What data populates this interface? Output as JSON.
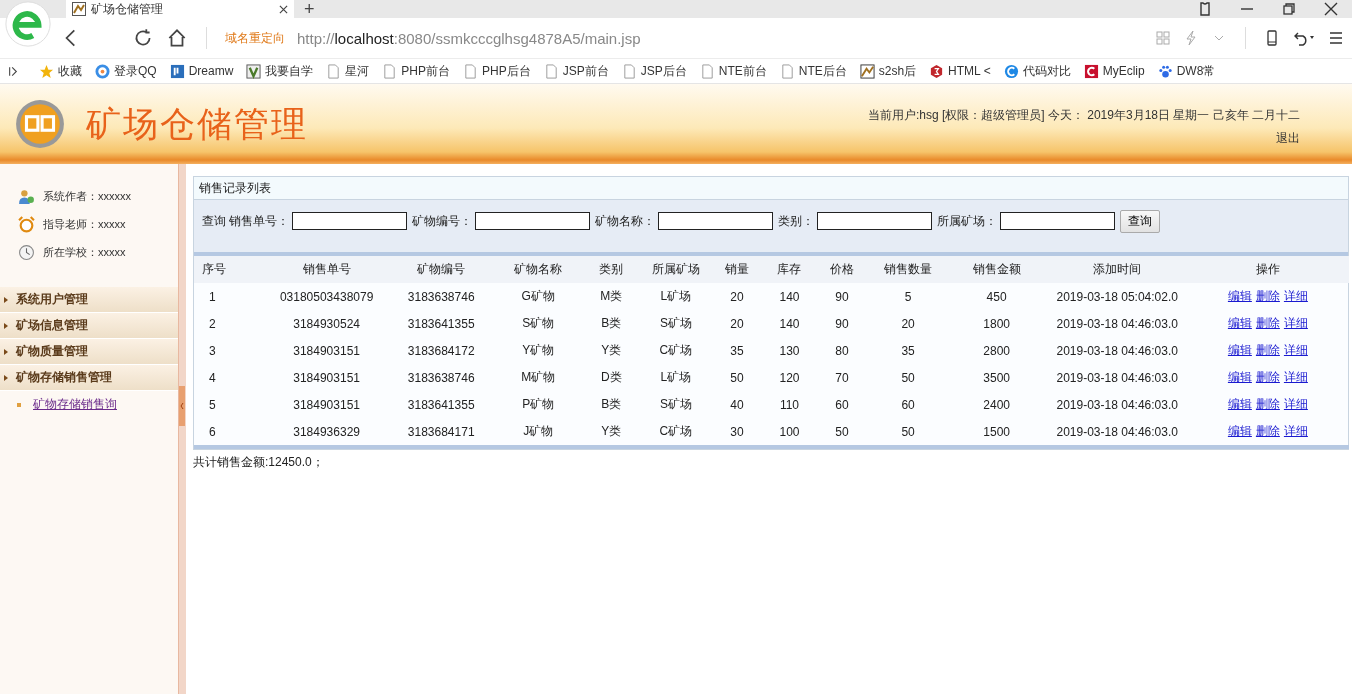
{
  "browser": {
    "tab_title": "矿场仓储管理",
    "new_tab": "+",
    "redirect_label": "域名重定向",
    "url": "http://**localhost**:8080/ssmkcccglhsg4878A5/main.jsp",
    "bookmarks": [
      {
        "label": "收藏",
        "kind": "star"
      },
      {
        "label": "登录QQ",
        "kind": "ring"
      },
      {
        "label": "Dreamw",
        "kind": "square"
      },
      {
        "label": "我要自学",
        "kind": "leaf"
      },
      {
        "label": "星河",
        "kind": "page"
      },
      {
        "label": "PHP前台",
        "kind": "page"
      },
      {
        "label": "PHP后台",
        "kind": "page"
      },
      {
        "label": "JSP前台",
        "kind": "page"
      },
      {
        "label": "JSP后台",
        "kind": "page"
      },
      {
        "label": "NTE前台",
        "kind": "page"
      },
      {
        "label": "NTE后台",
        "kind": "page"
      },
      {
        "label": "s2sh后",
        "kind": "image"
      },
      {
        "label": "HTML <",
        "kind": "hexagon"
      },
      {
        "label": "代码对比",
        "kind": "circle"
      },
      {
        "label": "MyEclip",
        "kind": "badge"
      },
      {
        "label": "DW8常",
        "kind": "paw"
      }
    ]
  },
  "header": {
    "title": "矿场仓储管理",
    "user_info": "当前用户:hsg [权限：超级管理员] 今天： 2019年3月18日 星期一 己亥年 二月十二",
    "logout": "退出"
  },
  "sidebar": {
    "info": [
      {
        "text": "系统作者：xxxxxx"
      },
      {
        "text": "指导老师：xxxxx"
      },
      {
        "text": "所在学校：xxxxx"
      }
    ],
    "menu": [
      {
        "label": "系统用户管理"
      },
      {
        "label": "矿场信息管理"
      },
      {
        "label": "矿物质量管理"
      },
      {
        "label": "矿物存储销售管理",
        "children": [
          {
            "label": "矿物存储销售询"
          }
        ]
      }
    ]
  },
  "panel": {
    "title": "销售记录列表",
    "search_label": "查询",
    "fields": [
      {
        "label": "销售单号："
      },
      {
        "label": "矿物编号："
      },
      {
        "label": "矿物名称："
      },
      {
        "label": "类别："
      },
      {
        "label": "所属矿场："
      }
    ],
    "search_button": "查询",
    "columns": [
      "序号",
      "销售单号",
      "矿物编号",
      "矿物名称",
      "类别",
      "所属矿场",
      "销量",
      "库存",
      "价格",
      "销售数量",
      "销售金额",
      "添加时间",
      "操作"
    ],
    "rows": [
      {
        "cells": [
          "1",
          "03180503438079",
          "3183638746",
          "G矿物",
          "M类",
          "L矿场",
          "20",
          "140",
          "90",
          "5",
          "450",
          "2019-03-18 05:04:02.0"
        ],
        "actions": [
          "编辑",
          "删除",
          "详细"
        ]
      },
      {
        "cells": [
          "2",
          "3184930524",
          "3183641355",
          "S矿物",
          "B类",
          "S矿场",
          "20",
          "140",
          "90",
          "20",
          "1800",
          "2019-03-18 04:46:03.0"
        ],
        "actions": [
          "编辑",
          "删除",
          "详细"
        ]
      },
      {
        "cells": [
          "3",
          "3184903151",
          "3183684172",
          "Y矿物",
          "Y类",
          "C矿场",
          "35",
          "130",
          "80",
          "35",
          "2800",
          "2019-03-18 04:46:03.0"
        ],
        "actions": [
          "编辑",
          "删除",
          "详细"
        ]
      },
      {
        "cells": [
          "4",
          "3184903151",
          "3183638746",
          "M矿物",
          "D类",
          "L矿场",
          "50",
          "120",
          "70",
          "50",
          "3500",
          "2019-03-18 04:46:03.0"
        ],
        "actions": [
          "编辑",
          "删除",
          "详细"
        ]
      },
      {
        "cells": [
          "5",
          "3184903151",
          "3183641355",
          "P矿物",
          "B类",
          "S矿场",
          "40",
          "110",
          "60",
          "60",
          "2400",
          "2019-03-18 04:46:03.0"
        ],
        "actions": [
          "编辑",
          "删除",
          "详细"
        ]
      },
      {
        "cells": [
          "6",
          "3184936329",
          "3183684171",
          "J矿物",
          "Y类",
          "C矿场",
          "30",
          "100",
          "50",
          "50",
          "1500",
          "2019-03-18 04:46:03.0"
        ],
        "actions": [
          "编辑",
          "删除",
          "详细"
        ]
      }
    ],
    "total": "共计销售金额:12450.0；"
  }
}
